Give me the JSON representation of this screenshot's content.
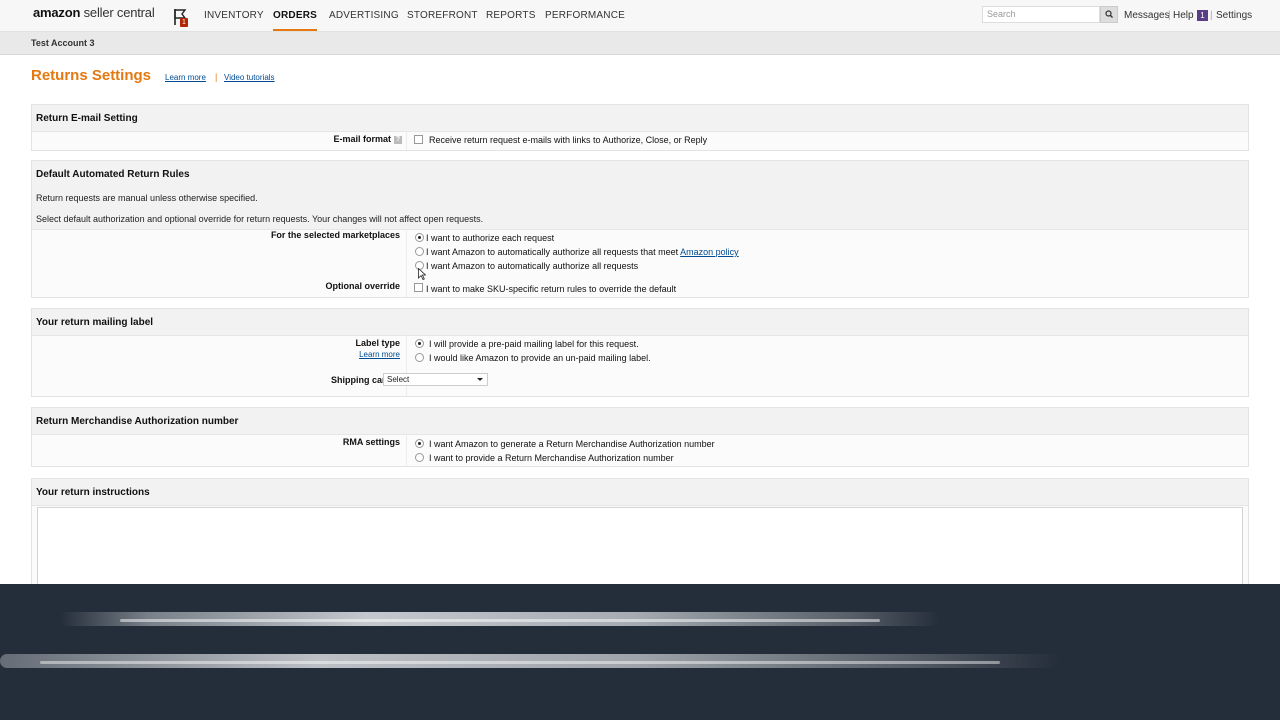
{
  "header": {
    "logo_brand": "amazon",
    "logo_rest": "seller central",
    "flag_count": "1",
    "nav": [
      {
        "label": "INVENTORY"
      },
      {
        "label": "ORDERS"
      },
      {
        "label": "ADVERTISING"
      },
      {
        "label": "STOREFRONT"
      },
      {
        "label": "REPORTS"
      },
      {
        "label": "PERFORMANCE"
      }
    ],
    "active_nav": "ORDERS",
    "search_placeholder": "Search",
    "messages": "Messages",
    "help": "Help",
    "help_count": "1",
    "settings": "Settings"
  },
  "account": {
    "name": "Test Account 3"
  },
  "page": {
    "title": "Returns Settings",
    "learn_more": "Learn more",
    "divider": "|",
    "video_tutorials": "Video tutorials"
  },
  "email_setting": {
    "heading": "Return E-mail Setting",
    "label": "E-mail format",
    "help_icon": "?",
    "option": "Receive return request e-mails with links to Authorize, Close, or Reply",
    "checked": false
  },
  "auto_rules": {
    "heading": "Default Automated Return Rules",
    "info1": "Return requests are manual unless otherwise specified.",
    "info2": "Select default authorization and optional override for return requests. Your changes will not affect open requests.",
    "marketplaces_label": "For the selected marketplaces",
    "options": [
      "I want to authorize each request",
      "I want Amazon to automatically authorize all requests that meet",
      "I want Amazon to automatically authorize all requests"
    ],
    "policy_link": "Amazon policy",
    "selected_index": 0,
    "override_label": "Optional override",
    "override_option": "I want to make SKU-specific return rules to override the default",
    "override_checked": false
  },
  "mailing_label": {
    "heading": "Your return mailing label",
    "label_type": "Label type",
    "learn_more": "Learn more",
    "options": [
      "I will provide a pre-paid mailing label for this request.",
      "I would like Amazon to provide an un-paid mailing label."
    ],
    "selected_index": 0,
    "carrier_label": "Shipping carrier",
    "carrier_value": "Select"
  },
  "rma": {
    "heading": "Return Merchandise Authorization number",
    "label": "RMA settings",
    "options": [
      "I want Amazon to generate a Return Merchandise Authorization number",
      "I want to provide a Return Merchandise Authorization number"
    ],
    "selected_index": 0
  },
  "instructions": {
    "heading": "Your return instructions",
    "value": ""
  },
  "colors": {
    "accent": "#e47911",
    "link": "#004b91",
    "overlay": "#242d3a"
  }
}
